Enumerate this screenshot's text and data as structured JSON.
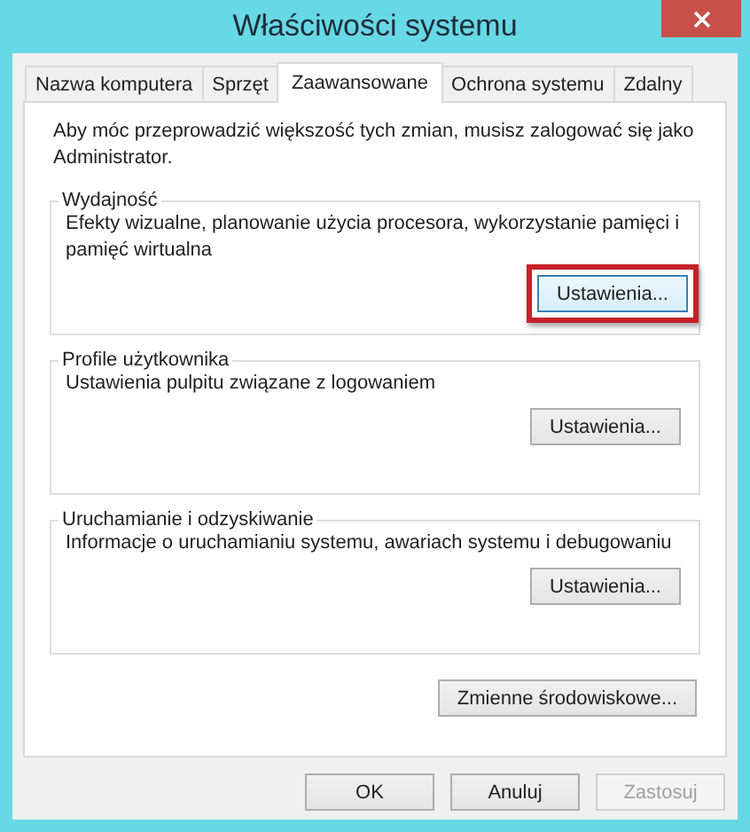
{
  "window": {
    "title": "Właściwości systemu"
  },
  "tabs": [
    {
      "label": "Nazwa komputera",
      "selected": false
    },
    {
      "label": "Sprzęt",
      "selected": false
    },
    {
      "label": "Zaawansowane",
      "selected": true
    },
    {
      "label": "Ochrona systemu",
      "selected": false
    },
    {
      "label": "Zdalny",
      "selected": false
    }
  ],
  "notice": "Aby móc przeprowadzić większość tych zmian, musisz zalogować się jako Administrator.",
  "groups": [
    {
      "title": "Wydajność",
      "description": "Efekty wizualne, planowanie użycia procesora, wykorzystanie pamięci i pamięć wirtualna",
      "button": {
        "label": "Ustawienia...",
        "focused": true,
        "highlighted": true
      }
    },
    {
      "title": "Profile użytkownika",
      "description": "Ustawienia pulpitu związane z logowaniem",
      "button": {
        "label": "Ustawienia...",
        "focused": false,
        "highlighted": false
      }
    },
    {
      "title": "Uruchamianie i odzyskiwanie",
      "description": "Informacje o uruchamianiu systemu, awariach systemu i debugowaniu",
      "button": {
        "label": "Ustawienia...",
        "focused": false,
        "highlighted": false
      }
    }
  ],
  "environment_button": {
    "label": "Zmienne środowiskowe..."
  },
  "buttons": [
    {
      "label": "OK",
      "disabled": false
    },
    {
      "label": "Anuluj",
      "disabled": false
    },
    {
      "label": "Zastosuj",
      "disabled": true
    }
  ]
}
